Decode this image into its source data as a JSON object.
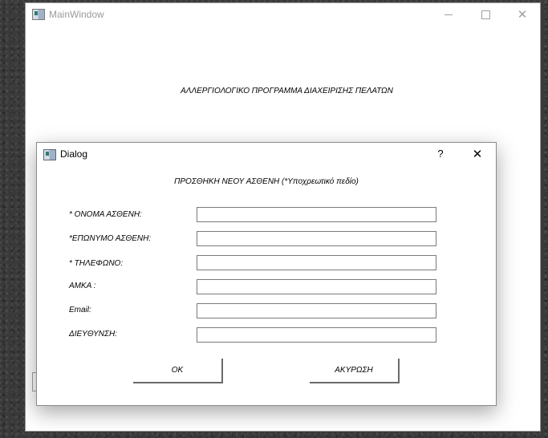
{
  "main_window": {
    "title": "MainWindow",
    "heading": "ΑΛΛΕΡΓΙΟΛΟΓΙΚΟ ΠΡΟΓΡΑΜΜΑ ΔΙΑΧΕΙΡΙΣΗΣ ΠΕΛΑΤΩΝ",
    "controls": {
      "minimize_icon": "minimize-icon",
      "maximize_icon": "maximize-icon",
      "close_glyph": "✕"
    }
  },
  "dialog": {
    "title": "Dialog",
    "help_label": "?",
    "close_glyph": "✕",
    "heading": "ΠΡΟΣΘΗΚΗ ΝΕΟΥ ΑΣΘΕΝΗ (*Υποχρεωτικό πεδίο)",
    "fields": [
      {
        "label": "* ΟΝΟΜΑ ΑΣΘΕΝΗ:",
        "value": ""
      },
      {
        "label": "*ΕΠΩΝΥΜΟ ΑΣΘΕΝΗ:",
        "value": ""
      },
      {
        "label": "* ΤΗΛΕΦΩΝΟ:",
        "value": ""
      },
      {
        "label": "ΑΜΚΑ :",
        "value": ""
      },
      {
        "label": "Email:",
        "value": ""
      },
      {
        "label": "ΔΙΕΥΘΥΝΣΗ:",
        "value": ""
      }
    ],
    "buttons": {
      "ok_label": "OK",
      "cancel_label": "ΑΚΥΡΩΣΗ"
    }
  }
}
